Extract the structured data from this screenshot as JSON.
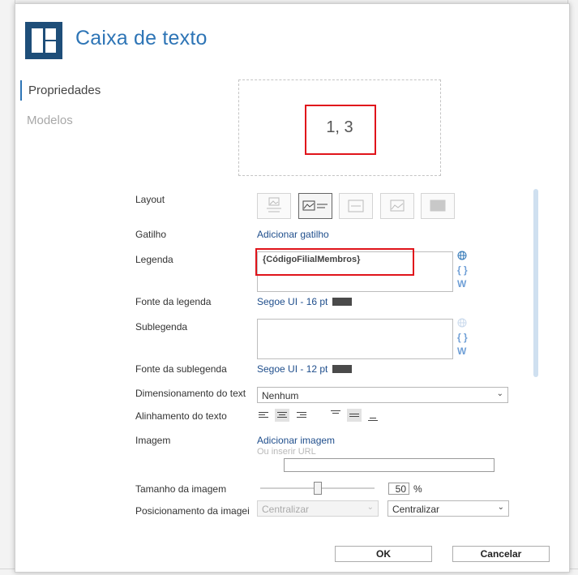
{
  "dialog": {
    "title": "Caixa de texto"
  },
  "nav": {
    "items": [
      "Propriedades",
      "Modelos"
    ]
  },
  "preview": {
    "text": "1, 3"
  },
  "fields": {
    "layout_label": "Layout",
    "trigger_label": "Gatilho",
    "trigger_link": "Adicionar gatilho",
    "caption_label": "Legenda",
    "caption_value": "{CódigoFilialMembros}",
    "caption_font_label": "Fonte da legenda",
    "caption_font": "Segoe UI - 16 pt",
    "subtitle_label": "Sublegenda",
    "subtitle_font_label": "Fonte da sublegenda",
    "subtitle_font": "Segoe UI - 12 pt",
    "sizing_label": "Dimensionamento do text",
    "sizing_value": "Nenhum",
    "text_align_label": "Alinhamento do texto",
    "image_label": "Imagem",
    "image_link": "Adicionar imagem",
    "url_placeholder": "Ou inserir URL",
    "image_size_label": "Tamanho da imagem",
    "image_size_value": "50",
    "image_size_unit": "%",
    "image_size_fraction": 0.5,
    "image_position_label": "Posicionamento da imagei",
    "image_position_h": "Centralizar",
    "image_position_v": "Centralizar"
  },
  "icons": {
    "globe": "globe-icon",
    "braces": "braces-icon",
    "w": "w-icon",
    "chevron": "chevron-down-icon"
  },
  "colors": {
    "accent": "#2e75b6",
    "highlight": "#e0141b",
    "link": "#1f4e8c",
    "logo": "#1e4e79"
  },
  "buttons": {
    "ok": "OK",
    "cancel": "Cancelar"
  }
}
